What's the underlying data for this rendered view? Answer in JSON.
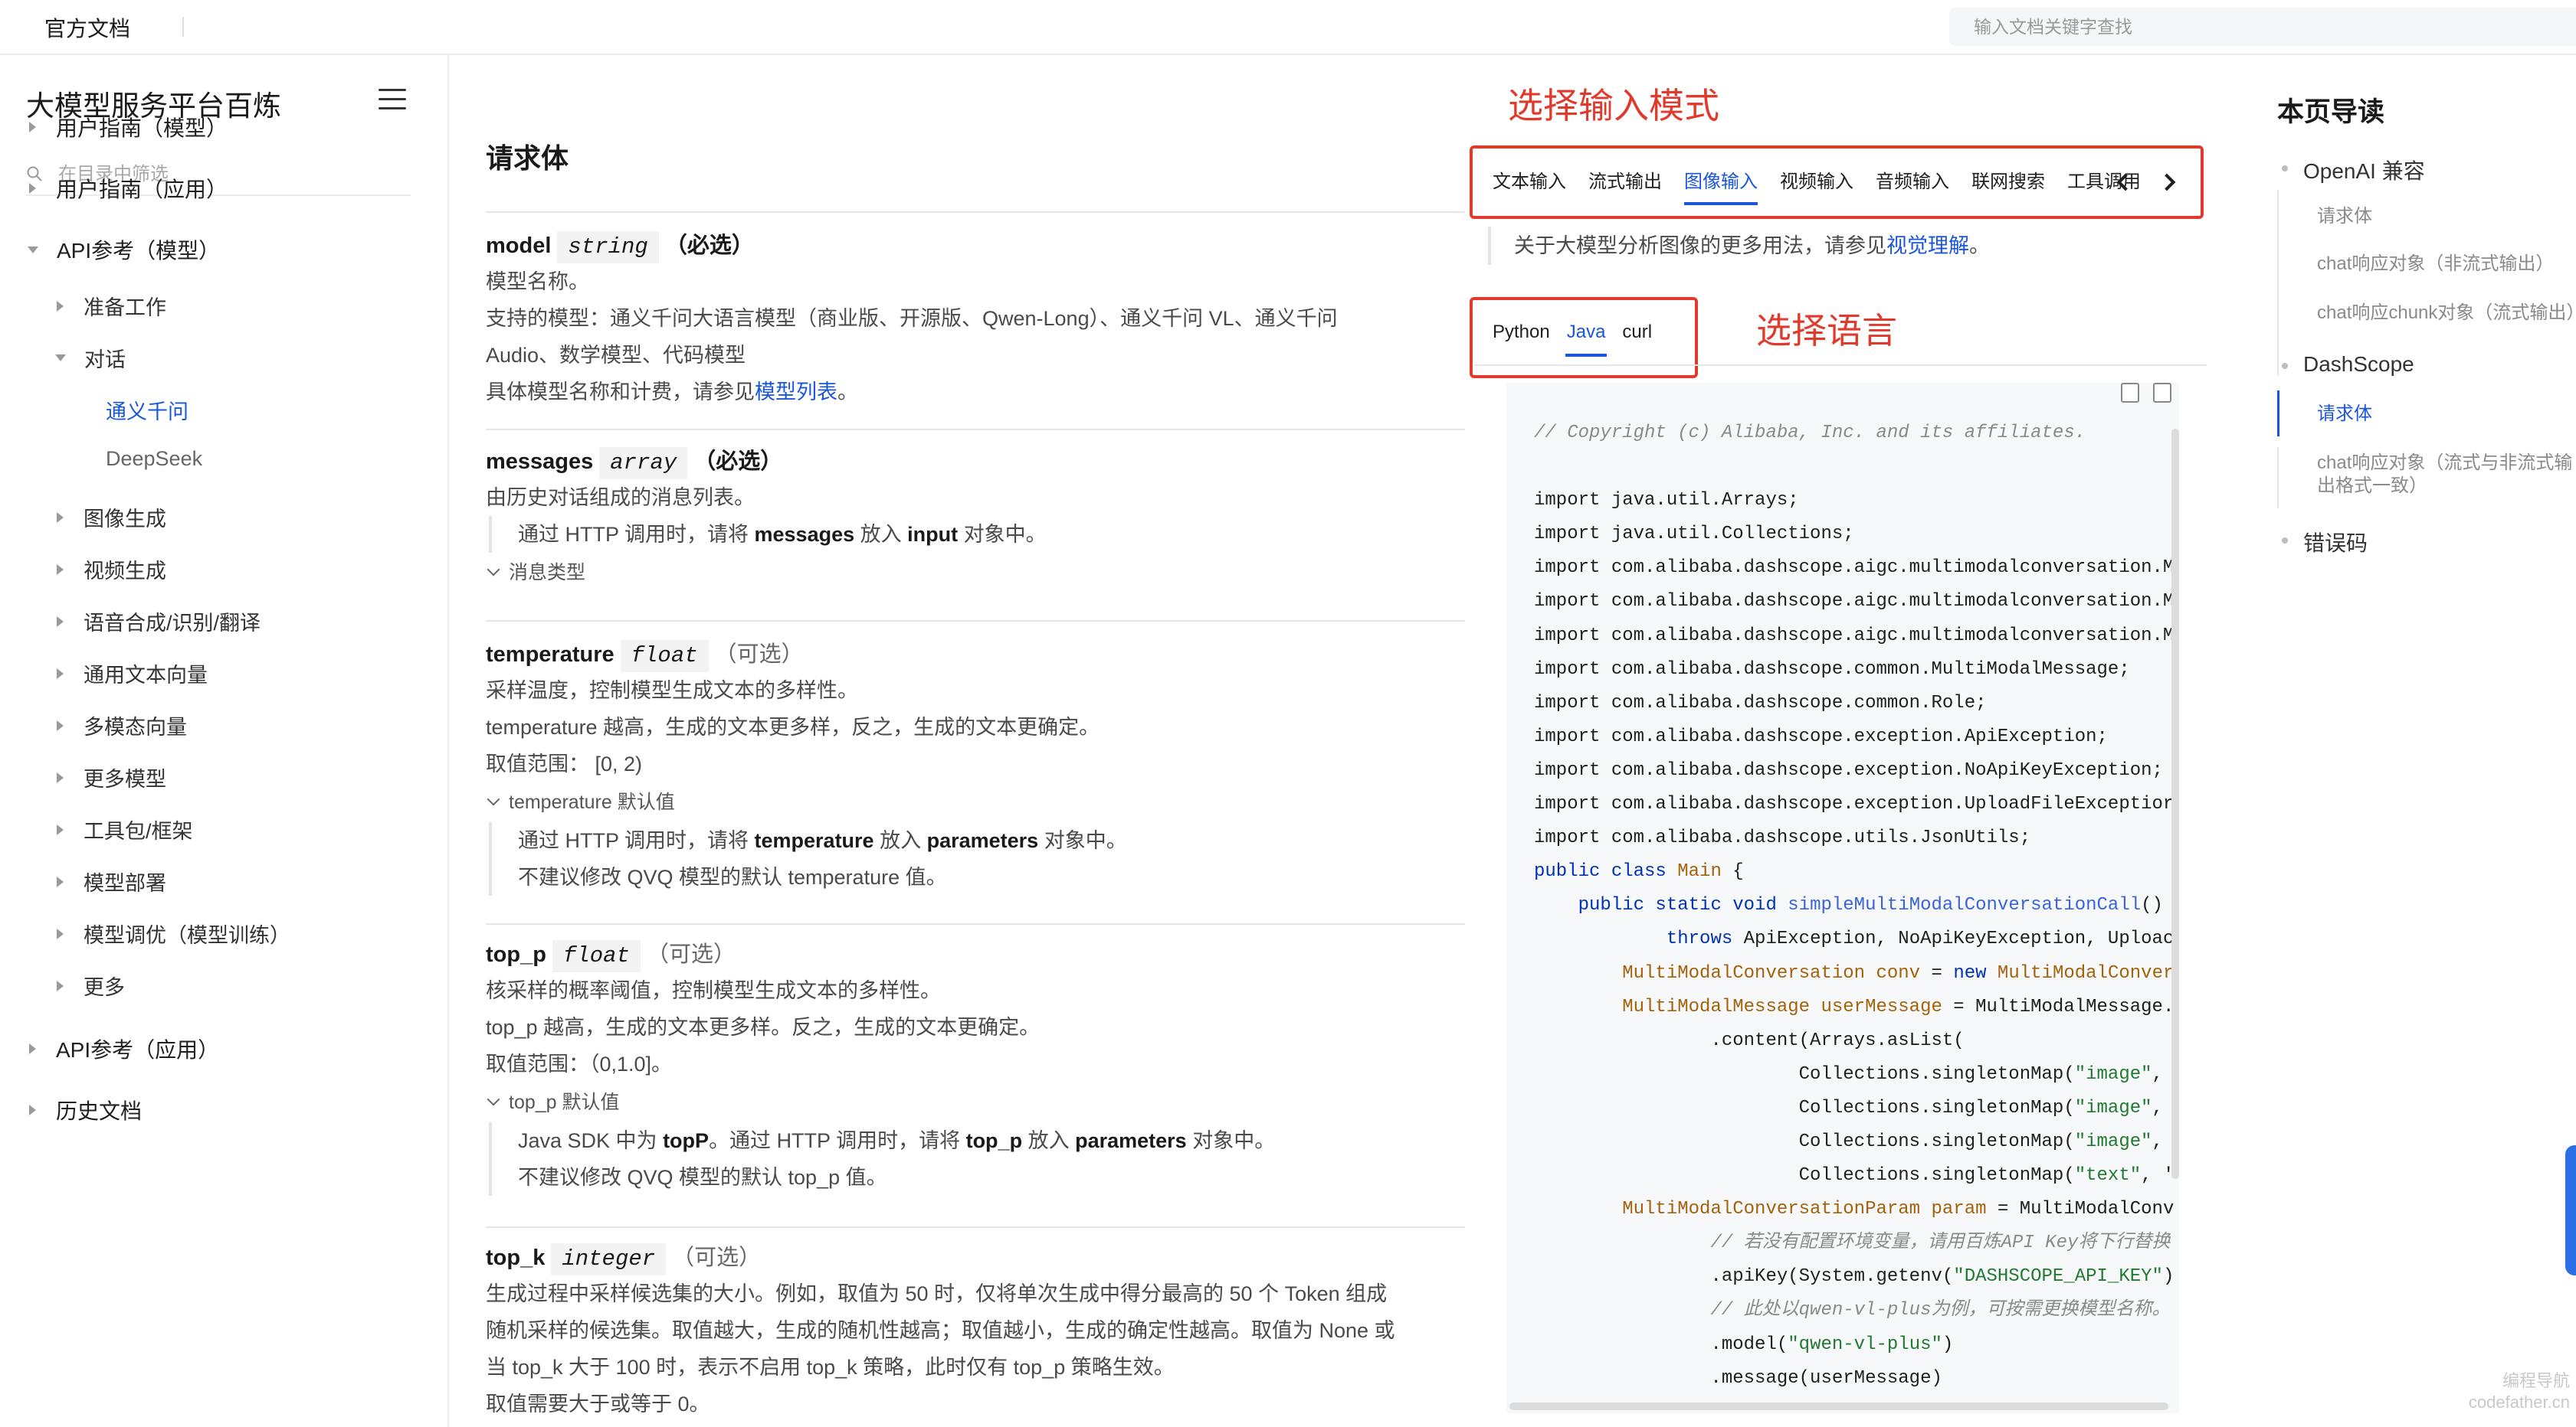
{
  "topbar": {
    "brand": "官方文档",
    "search_placeholder": "输入文档关键字查找"
  },
  "sidebar": {
    "title": "大模型服务平台百炼",
    "filter_placeholder": "在目录中筛选",
    "items": [
      {
        "label": "用户指南（模型）",
        "level": 0,
        "state": "collapsed"
      },
      {
        "label": "用户指南（应用）",
        "level": 0,
        "state": "collapsed"
      },
      {
        "label": "API参考（模型）",
        "level": 0,
        "state": "expanded"
      },
      {
        "label": "准备工作",
        "level": 1,
        "state": "collapsed"
      },
      {
        "label": "对话",
        "level": 1,
        "state": "expanded"
      },
      {
        "label": "通义千问",
        "level": 2,
        "state": "active"
      },
      {
        "label": "DeepSeek",
        "level": 2,
        "state": "leaf"
      },
      {
        "label": "图像生成",
        "level": 1,
        "state": "collapsed"
      },
      {
        "label": "视频生成",
        "level": 1,
        "state": "collapsed"
      },
      {
        "label": "语音合成/识别/翻译",
        "level": 1,
        "state": "collapsed"
      },
      {
        "label": "通用文本向量",
        "level": 1,
        "state": "collapsed"
      },
      {
        "label": "多模态向量",
        "level": 1,
        "state": "collapsed"
      },
      {
        "label": "更多模型",
        "level": 1,
        "state": "collapsed"
      },
      {
        "label": "工具包/框架",
        "level": 1,
        "state": "collapsed"
      },
      {
        "label": "模型部署",
        "level": 1,
        "state": "collapsed"
      },
      {
        "label": "模型调优（模型训练）",
        "level": 1,
        "state": "collapsed"
      },
      {
        "label": "更多",
        "level": 1,
        "state": "collapsed"
      },
      {
        "label": "API参考（应用）",
        "level": 0,
        "state": "collapsed"
      },
      {
        "label": "历史文档",
        "level": 0,
        "state": "collapsed"
      }
    ]
  },
  "main": {
    "heading": "请求体",
    "params": {
      "model": {
        "name": "model",
        "type": "string",
        "req": "（必选）",
        "l1": "模型名称。",
        "l2": "支持的模型：通义千问大语言模型（商业版、开源版、Qwen-Long）、通义千问 VL、通义千问",
        "l3": "Audio、数学模型、代码模型",
        "l4_pre": "具体模型名称和计费，请参见",
        "l4_link": "模型列表",
        "l4_post": "。"
      },
      "messages": {
        "name": "messages",
        "type": "array",
        "req": "（必选）",
        "l1": "由历史对话组成的消息列表。",
        "q_pre": "通过 HTTP 调用时，请将 ",
        "q_b1": "messages",
        "q_mid": " 放入 ",
        "q_b2": "input",
        "q_post": " 对象中。",
        "collapse": "消息类型"
      },
      "temperature": {
        "name": "temperature",
        "type": "float",
        "req": "（可选）",
        "l1": "采样温度，控制模型生成文本的多样性。",
        "l2": "temperature 越高，生成的文本更多样，反之，生成的文本更确定。",
        "l3": "取值范围： [0, 2)",
        "collapse": "temperature 默认值",
        "q1_pre": "通过 HTTP 调用时，请将 ",
        "q1_b1": "temperature",
        "q1_mid": " 放入 ",
        "q1_b2": "parameters",
        "q1_post": " 对象中。",
        "q2": "不建议修改 QVQ 模型的默认 temperature 值。"
      },
      "top_p": {
        "name": "top_p",
        "type": "float",
        "req": "（可选）",
        "l1": "核采样的概率阈值，控制模型生成文本的多样性。",
        "l2": "top_p 越高，生成的文本更多样。反之，生成的文本更确定。",
        "l3": "取值范围：（0,1.0]。",
        "collapse": "top_p 默认值",
        "q1_pre": "Java SDK 中为 ",
        "q1_b1": "topP",
        "q1_mid": "。通过 HTTP 调用时，请将 ",
        "q1_b2": "top_p",
        "q1_mid2": " 放入 ",
        "q1_b3": "parameters",
        "q1_post": " 对象中。",
        "q2": "不建议修改 QVQ 模型的默认 top_p 值。"
      },
      "top_k": {
        "name": "top_k",
        "type": "integer",
        "req": "（可选）",
        "l1": "生成过程中采样候选集的大小。例如，取值为 50 时，仅将单次生成中得分最高的 50 个 Token 组成",
        "l2": "随机采样的候选集。取值越大，生成的随机性越高；取值越小，生成的确定性越高。取值为 None 或",
        "l3": "当 top_k 大于 100 时，表示不启用 top_k 策略，此时仅有 top_p 策略生效。",
        "l4": "取值需要大于或等于 0。"
      }
    }
  },
  "code_panel": {
    "annotation_mode": "选择输入模式",
    "annotation_lang": "选择语言",
    "tabs": [
      "文本输入",
      "流式输出",
      "图像输入",
      "视频输入",
      "音频输入",
      "联网搜索",
      "工具调用"
    ],
    "active_tab": "图像输入",
    "note_pre": "关于大模型分析图像的更多用法，请参见",
    "note_link": "视觉理解",
    "note_post": "。",
    "languages": [
      "Python",
      "Java",
      "curl"
    ],
    "active_language": "Java",
    "code": {
      "l01": "// Copyright (c) Alibaba, Inc. and its affiliates.",
      "l02": "import java.util.Arrays;",
      "l03": "import java.util.Collections;",
      "l04": "import com.alibaba.dashscope.aigc.multimodalconversation.M",
      "l05": "import com.alibaba.dashscope.aigc.multimodalconversation.M",
      "l06": "import com.alibaba.dashscope.aigc.multimodalconversation.M",
      "l07": "import com.alibaba.dashscope.common.MultiModalMessage;",
      "l08": "import com.alibaba.dashscope.common.Role;",
      "l09": "import com.alibaba.dashscope.exception.ApiException;",
      "l10": "import com.alibaba.dashscope.exception.NoApiKeyException;",
      "l11": "import com.alibaba.dashscope.exception.UploadFileExceptior",
      "l12": "import com.alibaba.dashscope.utils.JsonUtils;",
      "l13_kw": "public class ",
      "l13_ty": "Main",
      "l13_rest": " {",
      "l14_kw": "    public static void ",
      "l14_fn": "simpleMultiModalConversationCall",
      "l14_rest": "()",
      "l15_kw": "            throws",
      "l15_rest": " ApiException, NoApiKeyException, Uploac",
      "l16_ty": "        MultiModalConversation conv",
      "l16_mid": " = ",
      "l16_kw": "new",
      "l16_ty2": " MultiModalConver",
      "l17_ty": "        MultiModalMessage userMessage",
      "l17_rest": " = MultiModalMessage.",
      "l18": "                .content(Arrays.asList(",
      "l19_pre": "                        Collections.singletonMap(",
      "l19_st": "\"image\"",
      "l19_post": ",",
      "l20_pre": "                        Collections.singletonMap(",
      "l20_st": "\"image\"",
      "l20_post": ",",
      "l21_pre": "                        Collections.singletonMap(",
      "l21_st": "\"image\"",
      "l21_post": ",",
      "l22_pre": "                        Collections.singletonMap(",
      "l22_st": "\"text\"",
      "l22_post": ", '",
      "l23_ty": "        MultiModalConversationParam param",
      "l23_rest": " = MultiModalConv",
      "l24": "                // 若没有配置环境变量，请用百炼API Key将下行替换",
      "l25_pre": "                .apiKey(System.getenv(",
      "l25_st": "\"DASHSCOPE_API_KEY\"",
      "l25_post": ")",
      "l26": "                // 此处以qwen-vl-plus为例，可按需更换模型名称。",
      "l27_pre": "                .model(",
      "l27_st": "\"qwen-vl-plus\"",
      "l27_post": ")",
      "l28": "                .message(userMessage)"
    }
  },
  "toc": {
    "title": "本页导读",
    "items": [
      {
        "label": "OpenAI 兼容",
        "level": 0
      },
      {
        "label": "请求体",
        "level": 1
      },
      {
        "label": "chat响应对象（非流式输出）",
        "level": 1
      },
      {
        "label": "chat响应chunk对象（流式输出）",
        "level": 1
      },
      {
        "label": "DashScope",
        "level": 0
      },
      {
        "label": "请求体",
        "level": 1,
        "active": true
      },
      {
        "label": "chat响应对象（流式与非流式输",
        "level": 1
      },
      {
        "label": "出格式一致）",
        "level": 1
      },
      {
        "label": "错误码",
        "level": 0
      }
    ]
  },
  "watermark": {
    "line1": "编程导航",
    "line2": "codefather.cn"
  },
  "colors": {
    "accent": "#1a56db",
    "annotation_red": "#e03a2c"
  }
}
